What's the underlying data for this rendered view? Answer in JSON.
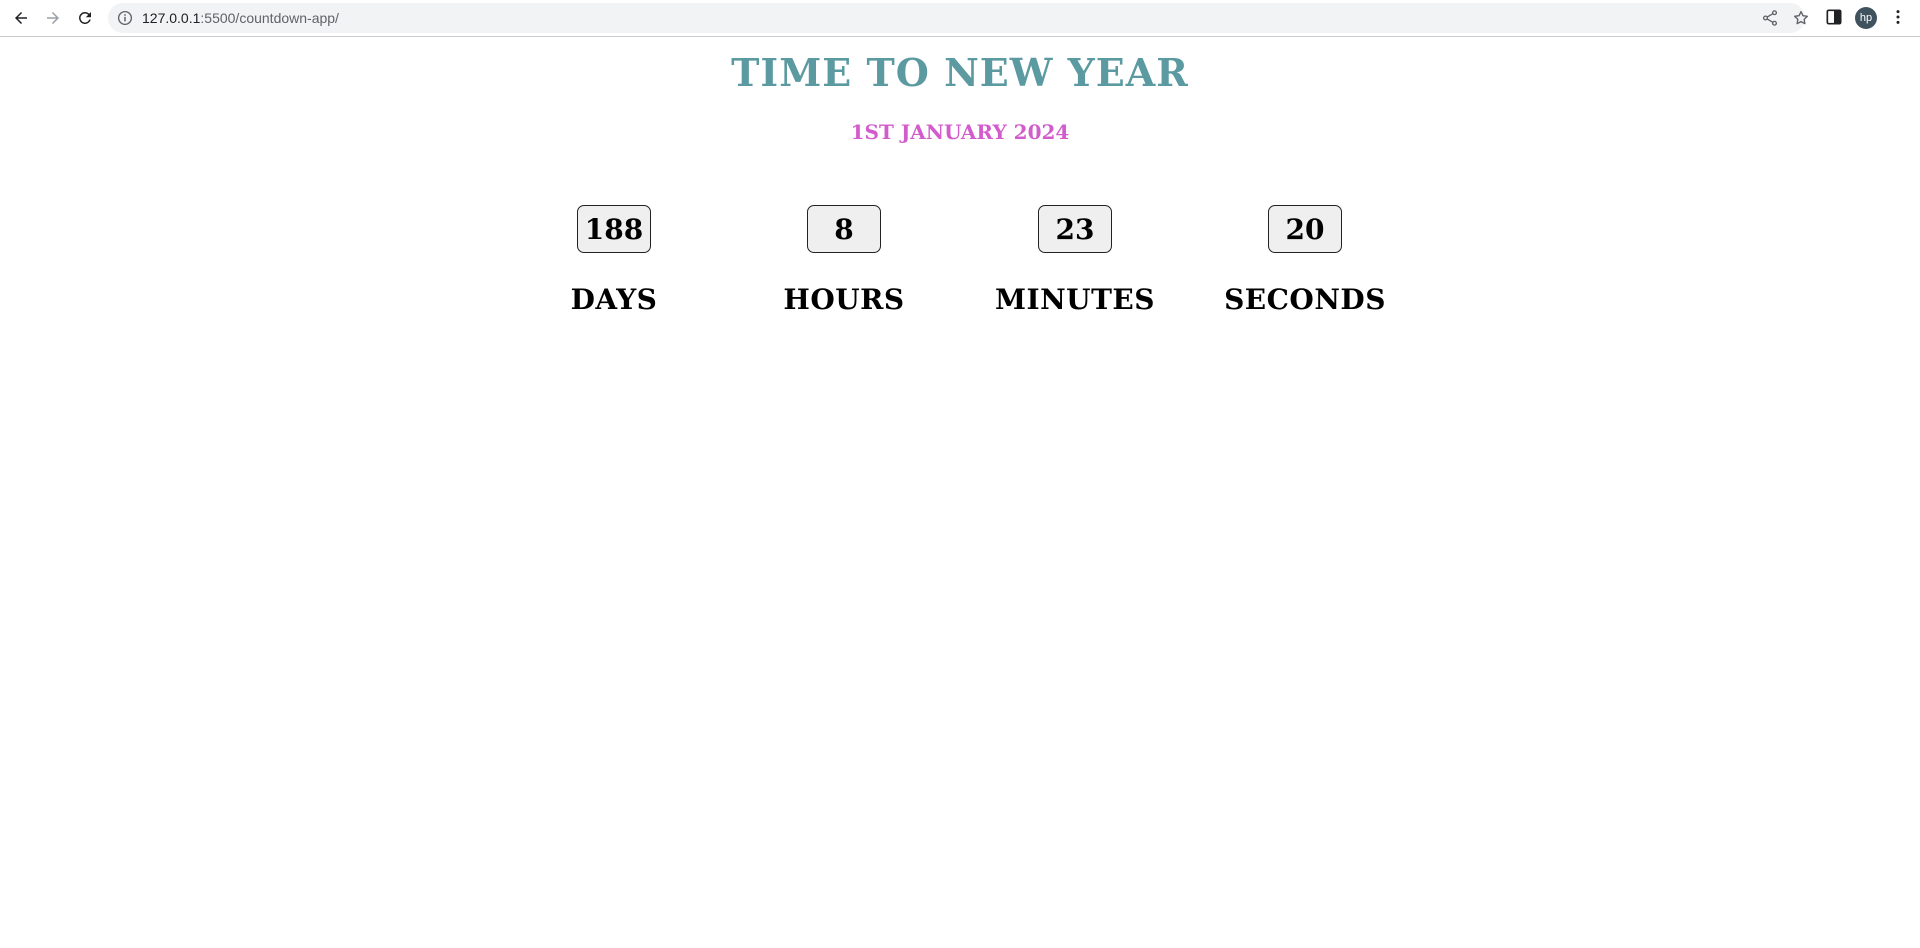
{
  "browser": {
    "url_host": "127.0.0.1",
    "url_rest": ":5500/countdown-app/",
    "profile_initials": "hp"
  },
  "page": {
    "title": "TIME TO NEW YEAR",
    "subtitle": "1ST JANUARY 2024",
    "countdown": [
      {
        "value": "188",
        "label": "DAYS"
      },
      {
        "value": "8",
        "label": "HOURS"
      },
      {
        "value": "23",
        "label": "MINUTES"
      },
      {
        "value": "20",
        "label": "SECONDS"
      }
    ],
    "colors": {
      "title": "#5a9aa0",
      "subtitle": "#d25ccc"
    }
  }
}
